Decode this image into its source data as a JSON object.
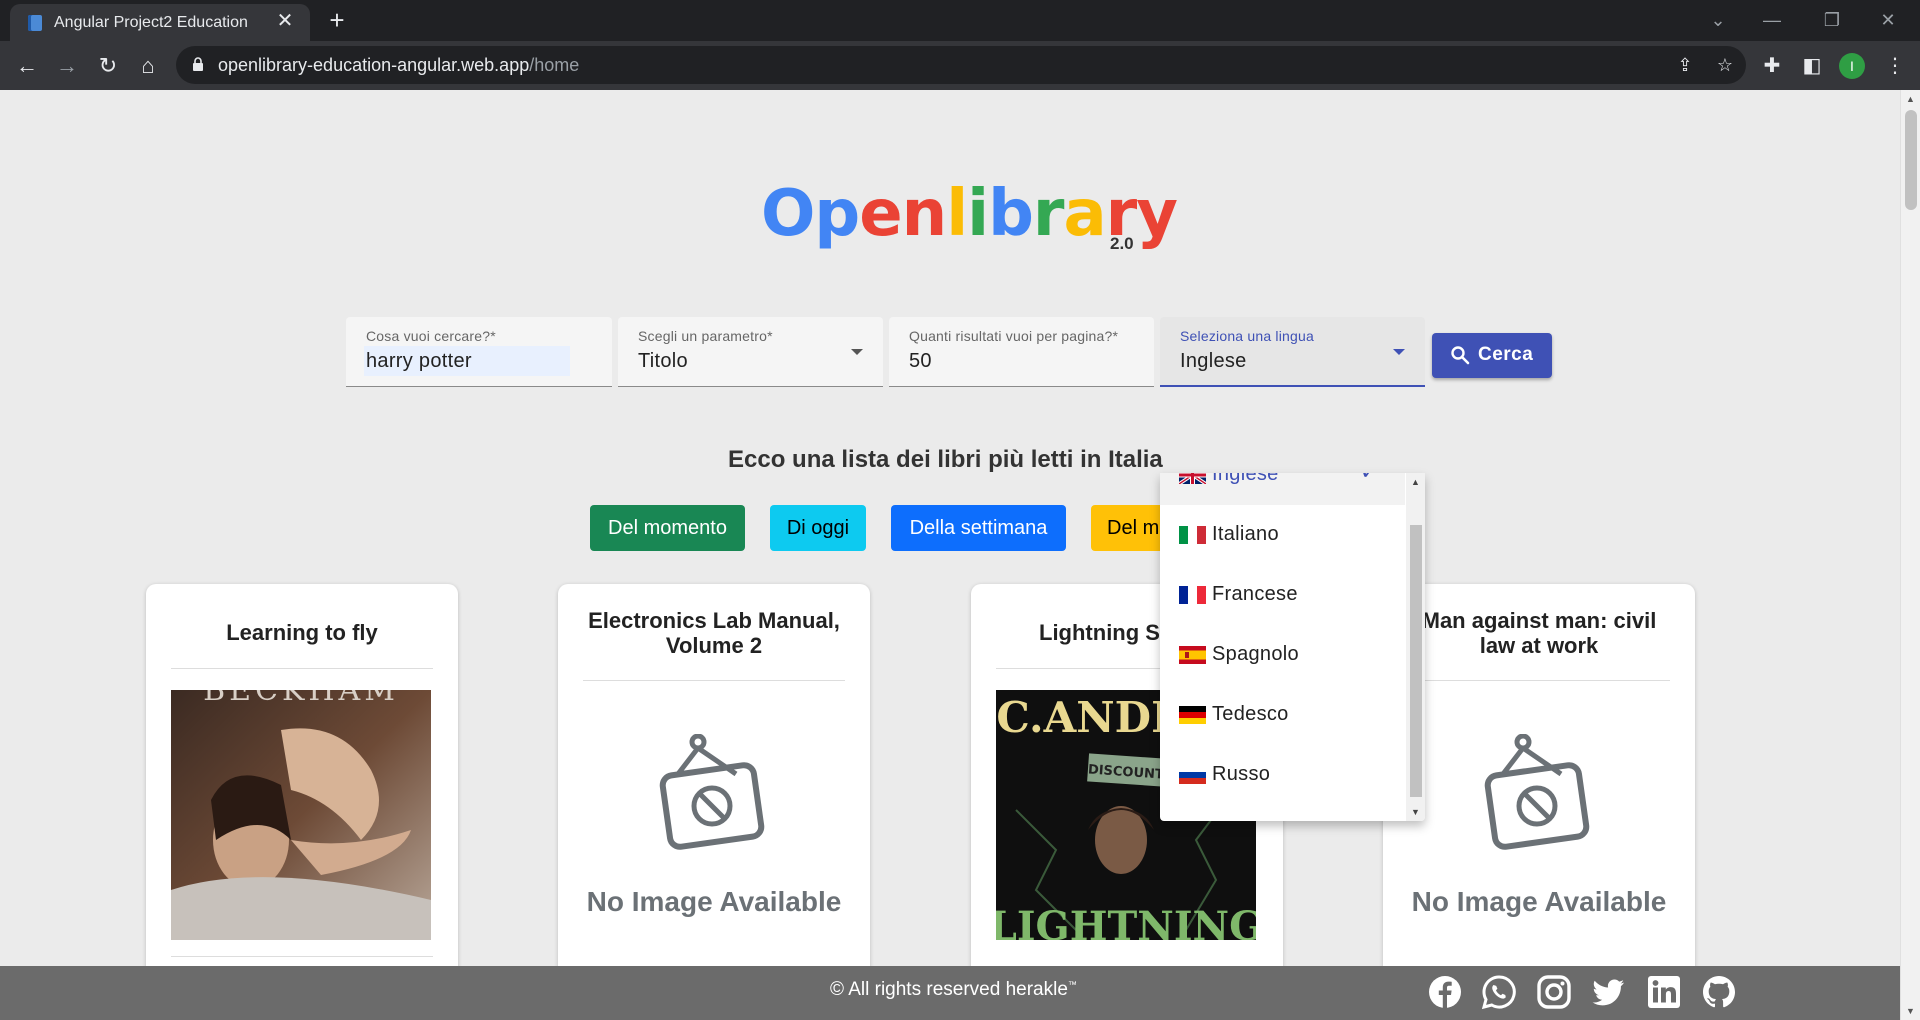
{
  "browser": {
    "tab_title": "Angular Project2 Education",
    "url_host": "openlibrary-education-angular.web.app",
    "url_path": "/home",
    "profile_initial": "I"
  },
  "logo": {
    "letters": [
      "O",
      "p",
      "e",
      "n",
      "l",
      "i",
      "b",
      "r",
      "a",
      "r",
      "y"
    ],
    "version": "2.0"
  },
  "search": {
    "query_label": "Cosa vuoi cercare?*",
    "query_value": "harry potter",
    "param_label": "Scegli un parametro*",
    "param_value": "Titolo",
    "results_label": "Quanti risultati vuoi per pagina?*",
    "results_value": "50",
    "language_label": "Seleziona una lingua",
    "language_value": "Inglese",
    "button_label": "Cerca"
  },
  "language_options": [
    {
      "label": "Inglese",
      "selected": true
    },
    {
      "label": "Italiano"
    },
    {
      "label": "Francese"
    },
    {
      "label": "Spagnolo"
    },
    {
      "label": "Tedesco"
    },
    {
      "label": "Russo"
    }
  ],
  "subtitle": "Ecco una lista dei libri più letti in Italia",
  "filters": [
    {
      "label": "Del momento",
      "color": "#198754"
    },
    {
      "label": "Di oggi",
      "color": "#0dcaf0"
    },
    {
      "label": "Della settimana",
      "color": "#0d6efd"
    },
    {
      "label": "Del m",
      "color": "#ffc107"
    }
  ],
  "books": [
    {
      "title": "Learning to fly",
      "has_image": true
    },
    {
      "title": "Electronics Lab Manual, Volume 2",
      "has_image": false
    },
    {
      "title": "Lightning St",
      "has_image": true
    },
    {
      "title": "Man against man: civil law at work",
      "has_image": false
    }
  ],
  "cover_text": {
    "book1": "BECKHAM",
    "book3_author": "V.C.ANDREWS",
    "book3_sticker": "DISCOUNT",
    "book3_bottom": "LIGHTNING"
  },
  "no_image_text": "No Image Available",
  "footer": {
    "text": "© All rights reserved herakle",
    "trademark": "™",
    "social_icons": [
      "facebook-icon",
      "whatsapp-icon",
      "instagram-icon",
      "twitter-icon",
      "linkedin-icon",
      "github-icon"
    ]
  }
}
